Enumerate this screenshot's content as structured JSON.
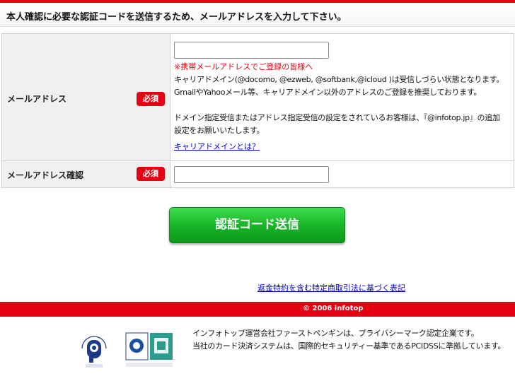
{
  "header": {
    "title": "本人確認に必要な認証コードを送信するため、メールアドレスを入力して下さい。"
  },
  "form": {
    "required_badge": "必須",
    "email": {
      "label": "メールアドレス",
      "value": "",
      "warning": "※携帯メールアドレスでご登録の皆様へ",
      "note1": "キャリアドメイン(@docomo, @ezweb, @softbank,@icloud )は受信しづらい状態となります。",
      "note2": "GmailやYahooメール等、キャリアドメイン以外のアドレスのご登録を推奨しております。",
      "note3": "ドメイン指定受信またはアドレス指定受信の設定をされているお客様は、『@infotop.jp』の追加",
      "note4": "設定をお願いいたします。",
      "link": "キャリアドメインとは？"
    },
    "email_confirm": {
      "label": "メールアドレス確認",
      "value": ""
    }
  },
  "submit": {
    "label": "認証コード送信"
  },
  "legal_link": "返金特約を含む特定商取引法に基づく表記",
  "footer": {
    "copyright": "© 2006  infotop",
    "line1": "インフォトップ運営会社ファーストペンギンは、プライバシーマーク認定企業です。",
    "line2": "当社のカード決済システムは、国際的セキュリティー基準であるPCIDSSに準拠しています。",
    "pmark_text": "たいせつにしますプライバシー",
    "pmark_number": "10823146",
    "iso_text": "ISMS-PCIDSS / PCI DSS"
  },
  "colors": {
    "brand_red": "#e60012",
    "button_green": "#16b226",
    "link_blue": "#0000cc"
  }
}
